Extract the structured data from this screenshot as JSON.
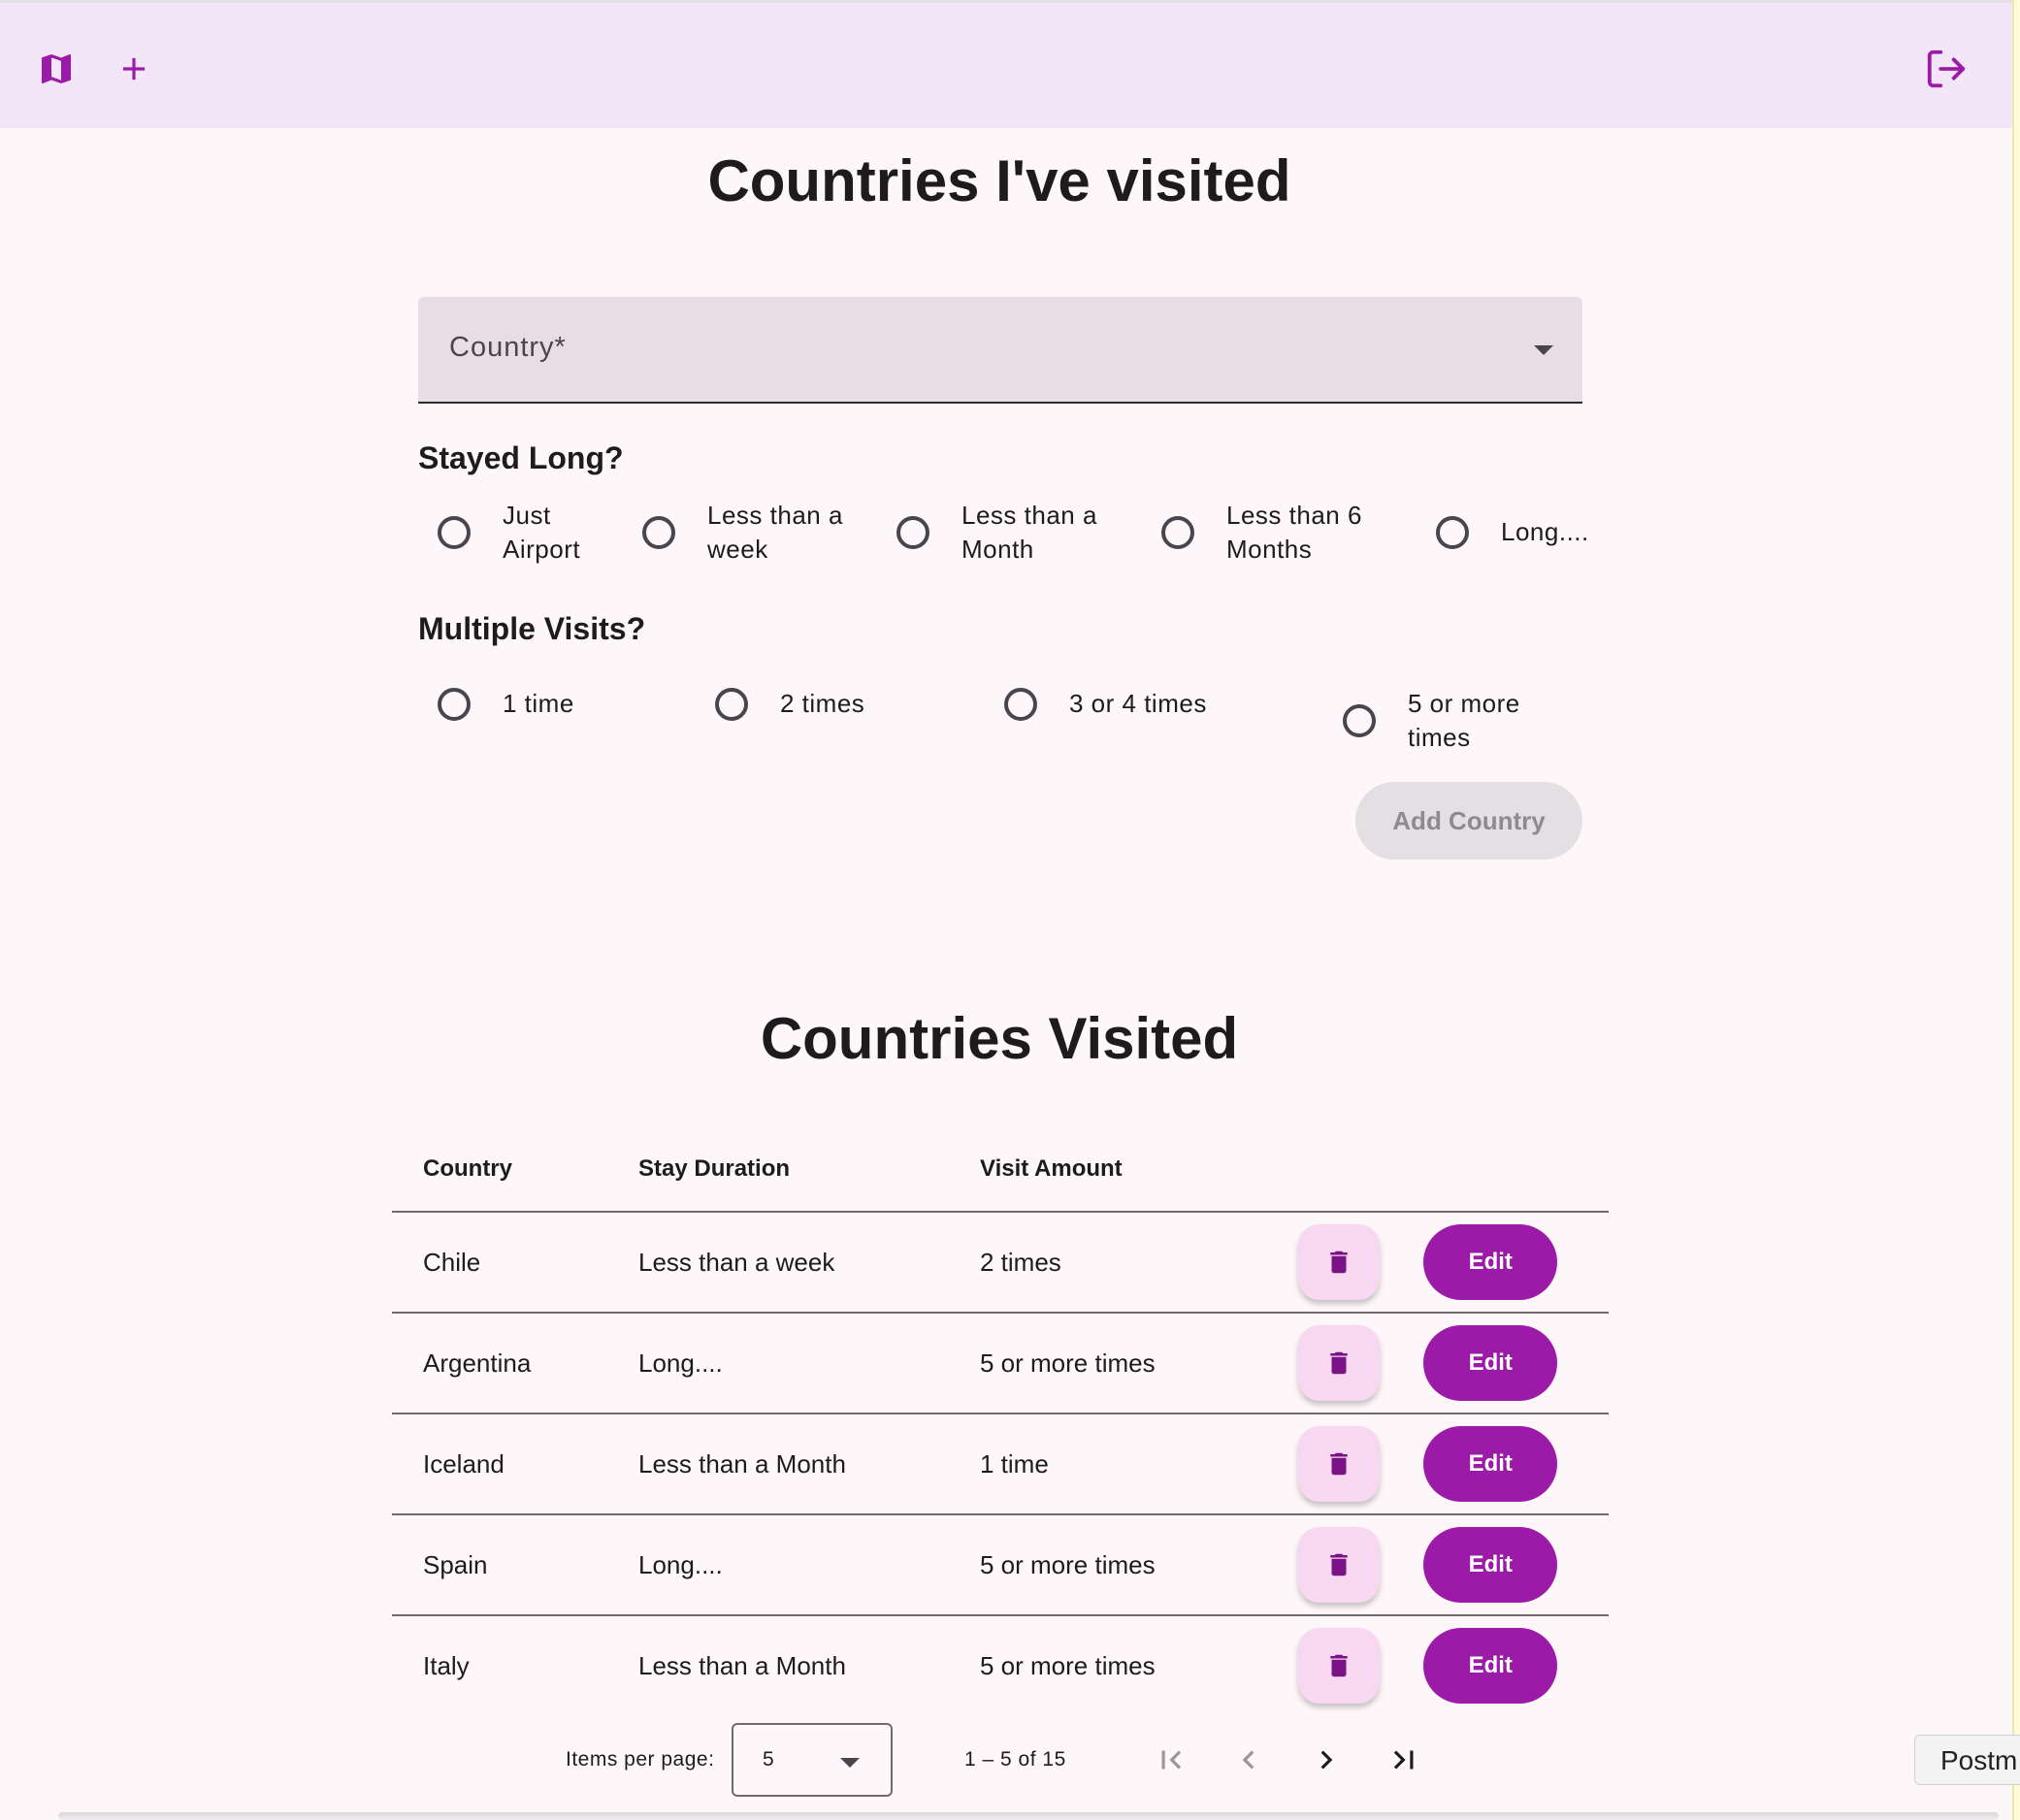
{
  "toolbar": {
    "left_icons": [
      "map-icon",
      "add-icon"
    ],
    "right_icons": [
      "logout-icon"
    ],
    "accent_color": "#9c1aa8",
    "background": "#f4e6f9"
  },
  "form": {
    "title": "Countries I've visited",
    "country_placeholder": "Country*",
    "stayed_long_label": "Stayed Long?",
    "stay_options": [
      {
        "line1": "Just",
        "line2": "Airport"
      },
      {
        "line1": "Less than a",
        "line2": "week"
      },
      {
        "line1": "Less than a",
        "line2": "Month"
      },
      {
        "line1": "Less than 6",
        "line2": "Months"
      },
      {
        "line1": "Long....",
        "line2": ""
      }
    ],
    "multiple_visits_label": "Multiple Visits?",
    "visit_options": [
      "1 time",
      "2 times",
      "3 or 4 times",
      "5 or more times"
    ],
    "add_button": "Add Country"
  },
  "table": {
    "title": "Countries Visited",
    "headers": [
      "Country",
      "Stay Duration",
      "Visit Amount"
    ],
    "edit_label": "Edit",
    "rows": [
      {
        "country": "Chile",
        "stay": "Less than a week",
        "visits": "2 times"
      },
      {
        "country": "Argentina",
        "stay": "Long....",
        "visits": "5 or more times"
      },
      {
        "country": "Iceland",
        "stay": "Less than a Month",
        "visits": "1 time"
      },
      {
        "country": "Spain",
        "stay": "Long....",
        "visits": "5 or more times"
      },
      {
        "country": "Italy",
        "stay": "Less than a Month",
        "visits": "5 or more times"
      }
    ]
  },
  "paginator": {
    "items_per_page_label": "Items per page:",
    "page_size": "5",
    "range_label": "1 – 5 of 15",
    "icons": [
      "first-page-icon",
      "previous-page-icon",
      "next-page-icon",
      "last-page-icon"
    ]
  },
  "tooltip": {
    "text": "Postm"
  }
}
